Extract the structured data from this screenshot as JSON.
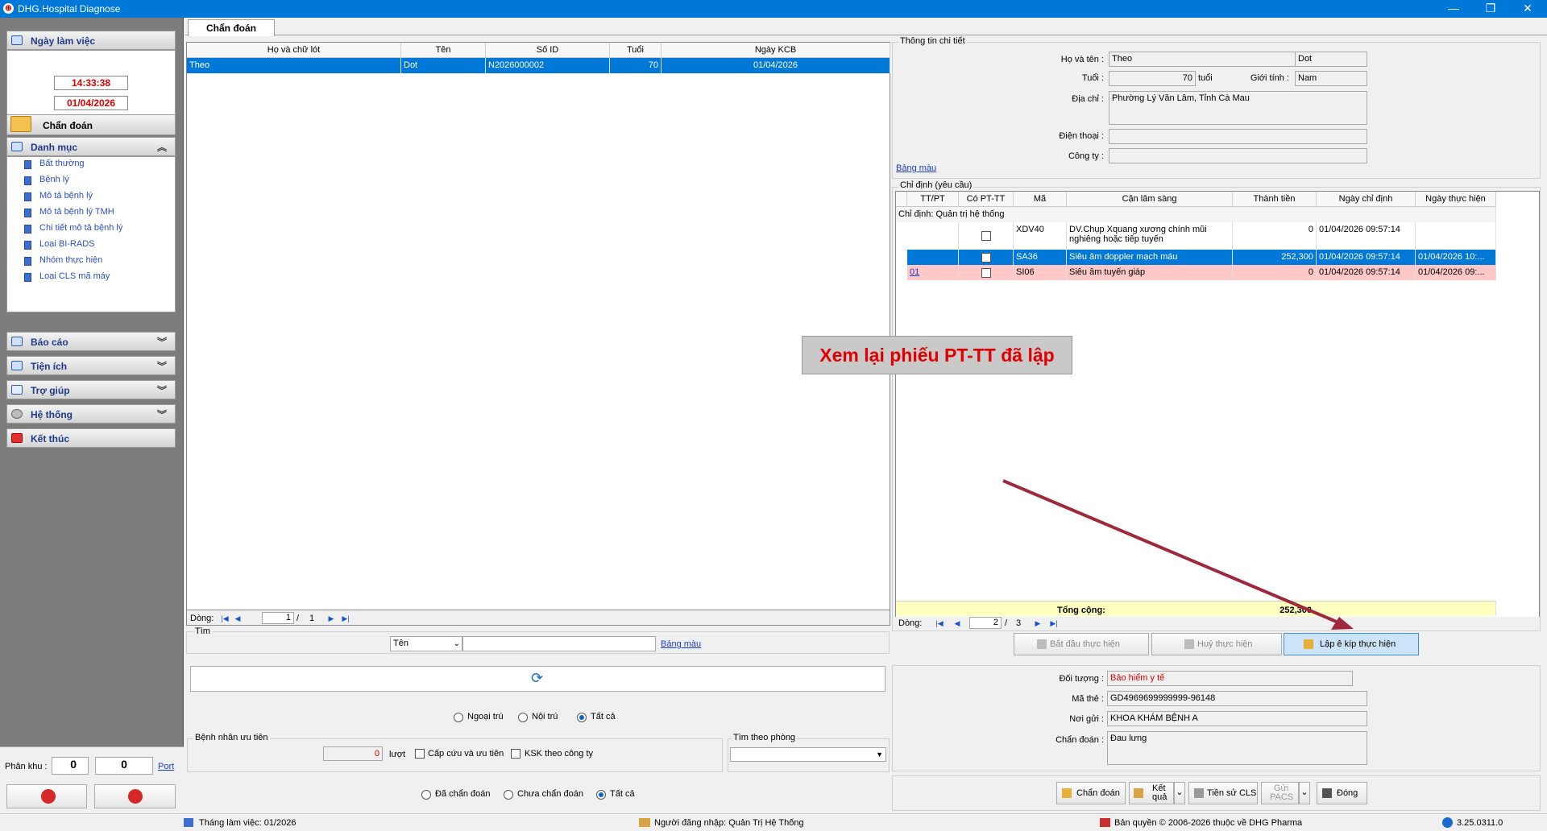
{
  "window": {
    "title": "DHG.Hospital Diagnose",
    "min": "—",
    "max": "❐",
    "close": "✕",
    "app_icon": "⊕"
  },
  "sidebar": {
    "workday_label": "Ngày làm việc",
    "time": "14:33:38",
    "date": "01/04/2026",
    "diagnose_label": "Chẩn đoán",
    "danhmuc_label": "Danh mục",
    "danhmuc_items": [
      "Bất thường",
      "Bệnh lý",
      "Mô tả bệnh lý",
      "Mô tả bệnh lý TMH",
      "Chi tiết mô tả bệnh lý",
      "Loại BI-RADS",
      "Nhóm thực hiện",
      "Loại CLS mã máy"
    ],
    "baocao_label": "Báo cáo",
    "tienich_label": "Tiện ích",
    "trogiup_label": "Trợ giúp",
    "hethong_label": "Hệ thống",
    "ketthuc_label": "Kết thúc",
    "phankhu_label": "Phân khu :",
    "phankhu_value": "0",
    "port_value": "0",
    "port_label": "Port",
    "chev_up": "⌃",
    "chev_down": "⌄",
    "chev_dbl": "︽",
    "chev_dbl_dn": "︾"
  },
  "tabs": {
    "active": "Chẩn đoán"
  },
  "patients": {
    "headers": [
      "Họ và chữ lót",
      "Tên",
      "Số ID",
      "Tuổi",
      "Ngày KCB"
    ],
    "rows": [
      [
        "Theo",
        "Dot",
        "N2026000002",
        "70",
        "01/04/2026"
      ]
    ],
    "pager_label": "Dòng:",
    "pager_page": "1",
    "pager_sep": "/",
    "pager_total": "1"
  },
  "search": {
    "group_label": "Tìm",
    "by_value": "Tên",
    "color_link": "Bảng màu",
    "visit_opts": [
      "Ngoại trú",
      "Nội trú",
      "Tất cả"
    ],
    "priority_label": "Bệnh nhân ưu tiên",
    "priority_count": "0",
    "priority_unit": "lượt",
    "emergency_label": "Cấp cứu và ưu tiên",
    "ksk_label": "KSK theo công ty",
    "room_label": "Tìm theo phòng",
    "diag_opts": [
      "Đã chẩn đoán",
      "Chưa chẩn đoán",
      "Tất cả"
    ],
    "refresh_icon": "⟳"
  },
  "detail": {
    "group_label": "Thông tin chi tiết",
    "name_label": "Họ và tên :",
    "first": "Theo",
    "last": "Dot",
    "age_label": "Tuổi :",
    "age": "70",
    "age_unit": "tuổi",
    "gender_label": "Giới tính :",
    "gender": "Nam",
    "address_label": "Địa chỉ :",
    "address": "Phường Lý Văn Lâm, Tỉnh Cà Mau",
    "phone_label": "Điện thoại :",
    "company_label": "Công ty :",
    "color_link": "Bảng màu"
  },
  "orders": {
    "group_label": "Chỉ định (yêu cầu)",
    "headers": [
      "TT/PT",
      "Có PT-TT",
      "Mã",
      "Cận lâm sàng",
      "Thành tiền",
      "Ngày chỉ định",
      "Ngày thực hiện"
    ],
    "group_row": "Chỉ định:  Quản trị hệ thống",
    "rows": [
      {
        "ttpt": "",
        "code": "XDV40",
        "name": "DV.Chụp Xquang xương chính mũi nghiêng hoặc tiếp tuyến",
        "amount": "0",
        "ordered": "01/04/2026 09:57:14",
        "done": ""
      },
      {
        "ttpt": "",
        "code": "SA36",
        "name": "Siêu âm doppler mạch máu",
        "amount": "252,300",
        "ordered": "01/04/2026 09:57:14",
        "done": "01/04/2026 10:..."
      },
      {
        "ttpt": "01",
        "code": "SI06",
        "name": "Siêu âm tuyến giáp",
        "amount": "0",
        "ordered": "01/04/2026 09:57:14",
        "done": "01/04/2026 09:..."
      }
    ],
    "total_label": "Tổng cộng:",
    "total": "252,300",
    "pager_label": "Dòng:",
    "pager_page": "2",
    "pager_sep": "/",
    "pager_total": "3",
    "annotation": "Xem lại phiếu PT-TT đã lập",
    "annotation_color": "#e00000",
    "arrow_color": "#a0283c"
  },
  "actions": {
    "start": "Bắt đầu thực hiện",
    "cancel": "Huỷ thực hiện",
    "ekip": "Lập ê kíp thực hiện"
  },
  "insurance": {
    "object_label": "Đối tượng :",
    "object": "Bảo hiểm y tế",
    "card_label": "Mã thẻ :",
    "card": "GD4969699999999-96148",
    "from_label": "Nơi gửi :",
    "from": "KHOA KHÁM BỆNH A",
    "diag_label": "Chẩn đoán :",
    "diag": "Đau lưng"
  },
  "bottom_buttons": {
    "diagnose": "Chẩn đoán",
    "result1": "Kết",
    "result2": "quả",
    "history": "Tiền sử CLS",
    "pacs1": "Gửi",
    "pacs2": "PACS",
    "close": "Đóng"
  },
  "status": {
    "month": "Tháng làm việc: 01/2026",
    "user": "Người đăng nhập: Quản Trị Hệ Thống",
    "copyright": "Bản quyền © 2006-2026 thuộc về DHG Pharma",
    "version": "3.25.0311.0"
  }
}
